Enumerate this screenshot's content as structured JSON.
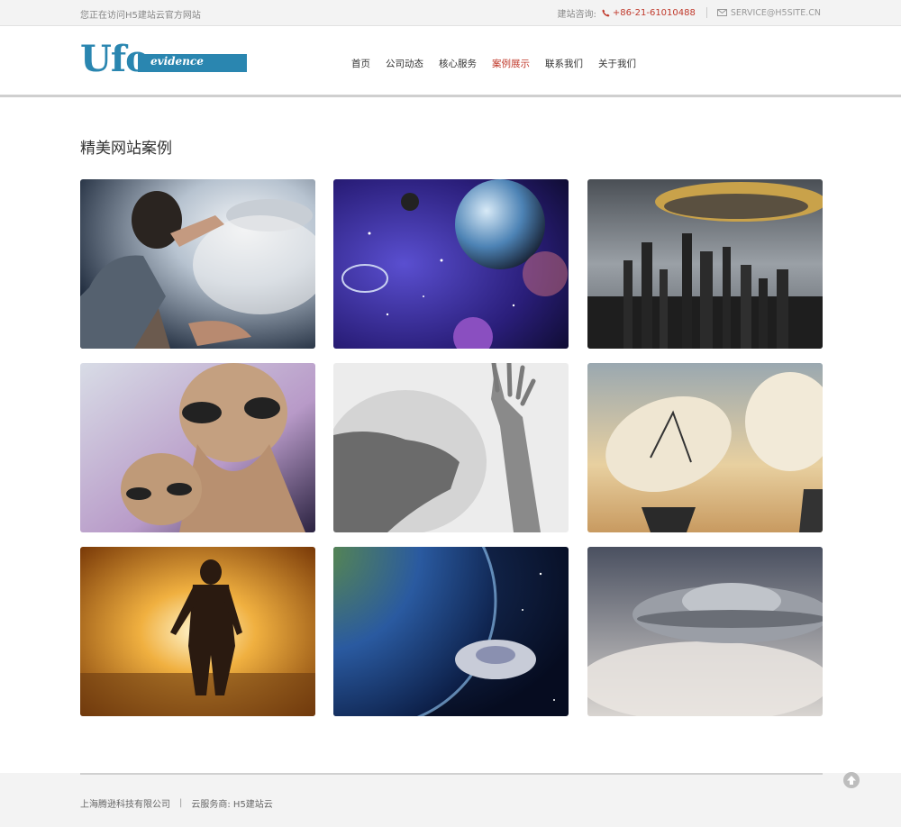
{
  "topbar": {
    "visiting": "您正在访问H5建站云官方网站",
    "consult_label": "建站咨询:",
    "phone": "+86-21-61010488",
    "email": "SERVICE@H5SITE.CN"
  },
  "logo": {
    "main": "Ufo",
    "sub": "evidence"
  },
  "nav": [
    {
      "label": "首页",
      "active": false
    },
    {
      "label": "公司动态",
      "active": false
    },
    {
      "label": "核心服务",
      "active": false
    },
    {
      "label": "案例展示",
      "active": true
    },
    {
      "label": "联系我们",
      "active": false
    },
    {
      "label": "关于我们",
      "active": false
    }
  ],
  "section_title": "精美网站案例",
  "gallery": [
    "man-reaching-toward-ufo",
    "planets-in-purple-space",
    "ufo-over-dark-city",
    "two-aliens",
    "shadow-hand-silhouette",
    "radio-telescope-dishes",
    "silhouette-in-golden-light",
    "earth-and-flying-saucer",
    "flying-saucer-in-clouds"
  ],
  "footer": {
    "company": "上海腾逊科技有限公司",
    "divider": "|",
    "provider": "云服务商: H5建站云"
  },
  "colors": {
    "accent": "#c0392b",
    "brand": "#2a86b0"
  },
  "icons": {
    "phone": "phone-icon",
    "mail": "mail-icon",
    "top": "arrow-up-circle-icon"
  }
}
